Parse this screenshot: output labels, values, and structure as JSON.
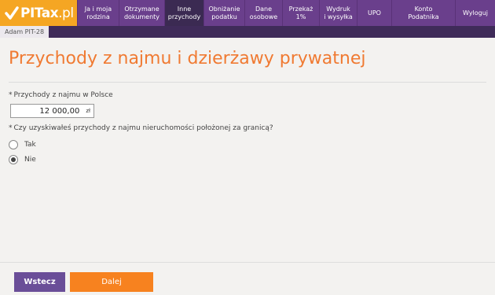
{
  "app": {
    "logo_text": "PITax",
    "logo_suffix": ".pl"
  },
  "nav": {
    "items": [
      {
        "line1": "Ja i moja",
        "line2": "rodzina"
      },
      {
        "line1": "Otrzymane",
        "line2": "dokumenty"
      },
      {
        "line1": "Inne",
        "line2": "przychody"
      },
      {
        "line1": "Obniżanie",
        "line2": "podatku"
      },
      {
        "line1": "Dane",
        "line2": "osobowe"
      },
      {
        "line1": "Przekaż",
        "line2": "1%"
      },
      {
        "line1": "Wydruk",
        "line2": "i wysyłka"
      },
      {
        "line1": "UPO",
        "line2": ""
      },
      {
        "line1": "Konto",
        "line2": "Podatnika"
      },
      {
        "line1": "Wyloguj",
        "line2": ""
      }
    ],
    "active_index": 2
  },
  "subbar": {
    "person_tab": "Adam PIT-28"
  },
  "main": {
    "title": "Przychody z najmu i dzierżawy prywatnej",
    "q1": {
      "star": "*",
      "label": "Przychody z najmu w Polsce",
      "value": "12 000,00",
      "unit": "zł"
    },
    "q2": {
      "star": "*",
      "label": "Czy uzyskiwałeś przychody z najmu nieruchomości położonej za granicą?",
      "options": [
        {
          "label": "Tak",
          "checked": false
        },
        {
          "label": "Nie",
          "checked": true
        }
      ]
    }
  },
  "footer": {
    "back_label": "Wstecz",
    "next_label": "Dalej"
  },
  "colors": {
    "nav_bg": "#6a3f8c",
    "nav_active": "#3b2a52",
    "logo_bg": "#f5a623",
    "title": "#f07a32",
    "back_btn": "#6a4e98",
    "next_btn": "#f7821f"
  }
}
